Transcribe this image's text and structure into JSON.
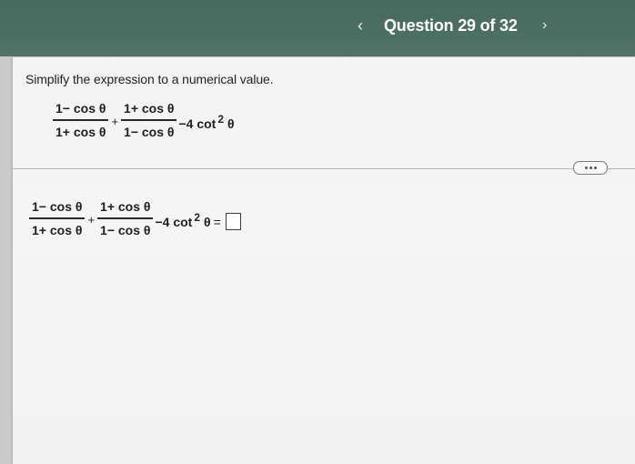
{
  "header": {
    "prev_icon": "chevron-left-icon",
    "prev_glyph": "‹",
    "title": "Question 29 of 32",
    "next_icon": "chevron-right-icon",
    "next_glyph": "›"
  },
  "question": {
    "prompt": "Simplify the expression to a numerical value.",
    "expression": {
      "term1_num": "1− cos θ",
      "term1_den": "1+ cos θ",
      "plus": "+",
      "term2_num": "1+ cos θ",
      "term2_den": "1− cos θ",
      "tail": "−4 cot",
      "exponent": "2",
      "variable": "θ"
    }
  },
  "more_button": {
    "icon": "more-horizontal-icon"
  },
  "answer": {
    "expression": {
      "term1_num": "1− cos θ",
      "term1_den": "1+ cos θ",
      "plus": "+",
      "term2_num": "1+ cos θ",
      "term2_den": "1− cos θ",
      "tail": "−4 cot",
      "exponent": "2",
      "variable": "θ",
      "equals": "="
    },
    "input_value": ""
  }
}
